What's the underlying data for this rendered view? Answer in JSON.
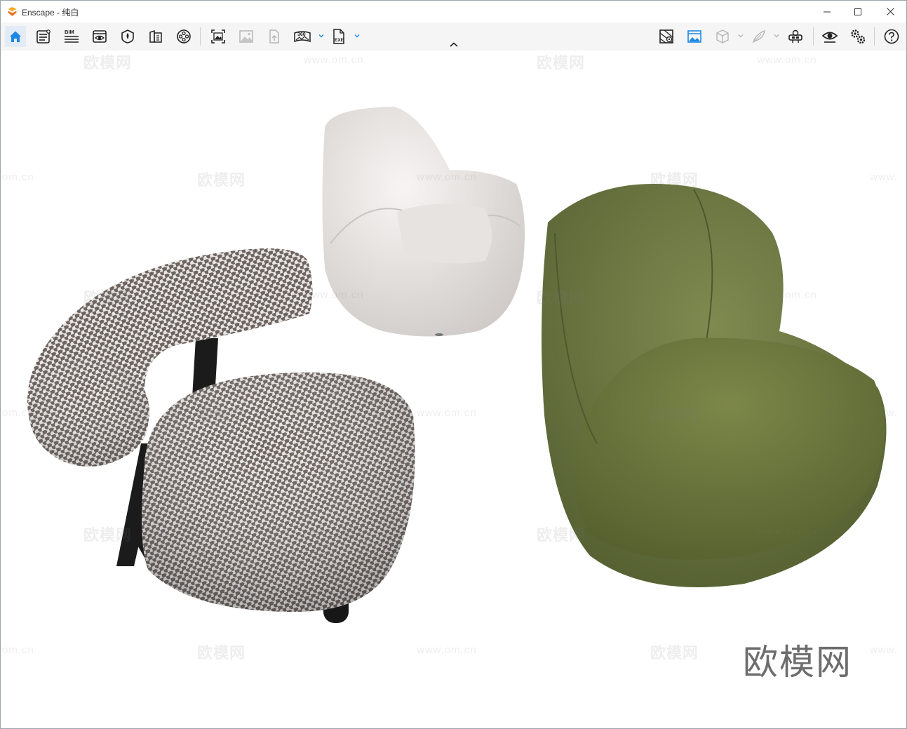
{
  "window": {
    "title": "Enscape - 纯白"
  },
  "toolbar": {
    "left_tools": [
      {
        "name": "home-icon",
        "active": true
      },
      {
        "name": "properties-icon"
      },
      {
        "name": "bim-icon",
        "label": "BIM"
      },
      {
        "name": "view-icon"
      },
      {
        "name": "asset-library-icon"
      },
      {
        "name": "material-editor-icon"
      },
      {
        "name": "video-editor-icon"
      }
    ],
    "capture_tools": [
      {
        "name": "screenshot-icon"
      },
      {
        "name": "batch-render-icon"
      },
      {
        "name": "upload-icon"
      },
      {
        "name": "panorama-360-icon",
        "label": "360"
      },
      {
        "name": "export-exe-icon",
        "label": "EXE"
      }
    ],
    "right_tools": [
      {
        "name": "map-icon"
      },
      {
        "name": "capture-manager-icon"
      },
      {
        "name": "cube-icon"
      },
      {
        "name": "feather-icon"
      },
      {
        "name": "vr-headset-icon"
      },
      {
        "name": "visual-settings-icon"
      },
      {
        "name": "general-settings-icon"
      },
      {
        "name": "help-icon"
      }
    ]
  },
  "viewport": {
    "watermark_text": "欧模网",
    "watermark_url": "www.om.cn",
    "watermark_url_partial": "om.cn",
    "watermark_url_start": "www.",
    "brand_mark": "欧模网",
    "scene": "three lounge chairs: houndstooth armless chair, white tub armchair, olive green fabric chair"
  },
  "colors": {
    "accent": "#1e88e5",
    "houndstooth_light": "#e8e4e4",
    "houndstooth_dark": "#6b625e",
    "white_chair": "#ece9e7",
    "green_chair": "#6b7540"
  }
}
